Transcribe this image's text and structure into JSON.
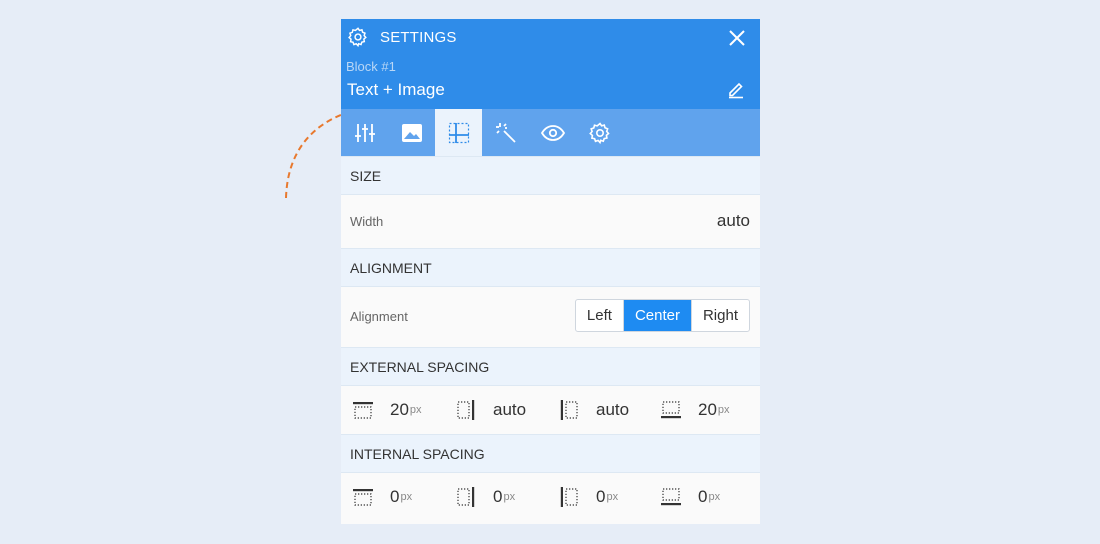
{
  "header": {
    "title": "SETTINGS",
    "block_label": "Block #1",
    "block_name": "Text + Image"
  },
  "tabs": [
    {
      "icon": "sliders-icon"
    },
    {
      "icon": "image-icon"
    },
    {
      "icon": "grid-layout-icon",
      "active": true
    },
    {
      "icon": "magic-wand-icon"
    },
    {
      "icon": "eye-icon"
    },
    {
      "icon": "gear-icon"
    }
  ],
  "size": {
    "heading": "SIZE",
    "width_label": "Width",
    "width_value": "auto"
  },
  "alignment": {
    "heading": "ALIGNMENT",
    "label": "Alignment",
    "options": [
      "Left",
      "Center",
      "Right"
    ],
    "selected": "Center"
  },
  "external_spacing": {
    "heading": "EXTERNAL SPACING",
    "top": {
      "value": "20",
      "unit": "px"
    },
    "right": {
      "value": "auto",
      "unit": ""
    },
    "left": {
      "value": "auto",
      "unit": ""
    },
    "bottom": {
      "value": "20",
      "unit": "px"
    }
  },
  "internal_spacing": {
    "heading": "INTERNAL SPACING",
    "top": {
      "value": "0",
      "unit": "px"
    },
    "right": {
      "value": "0",
      "unit": "px"
    },
    "left": {
      "value": "0",
      "unit": "px"
    },
    "bottom": {
      "value": "0",
      "unit": "px"
    }
  },
  "colors": {
    "header_bg": "#2f8ce9",
    "tabs_bg": "#60a3ed",
    "accent": "#1e8bf2",
    "arrow": "#e8792e"
  }
}
